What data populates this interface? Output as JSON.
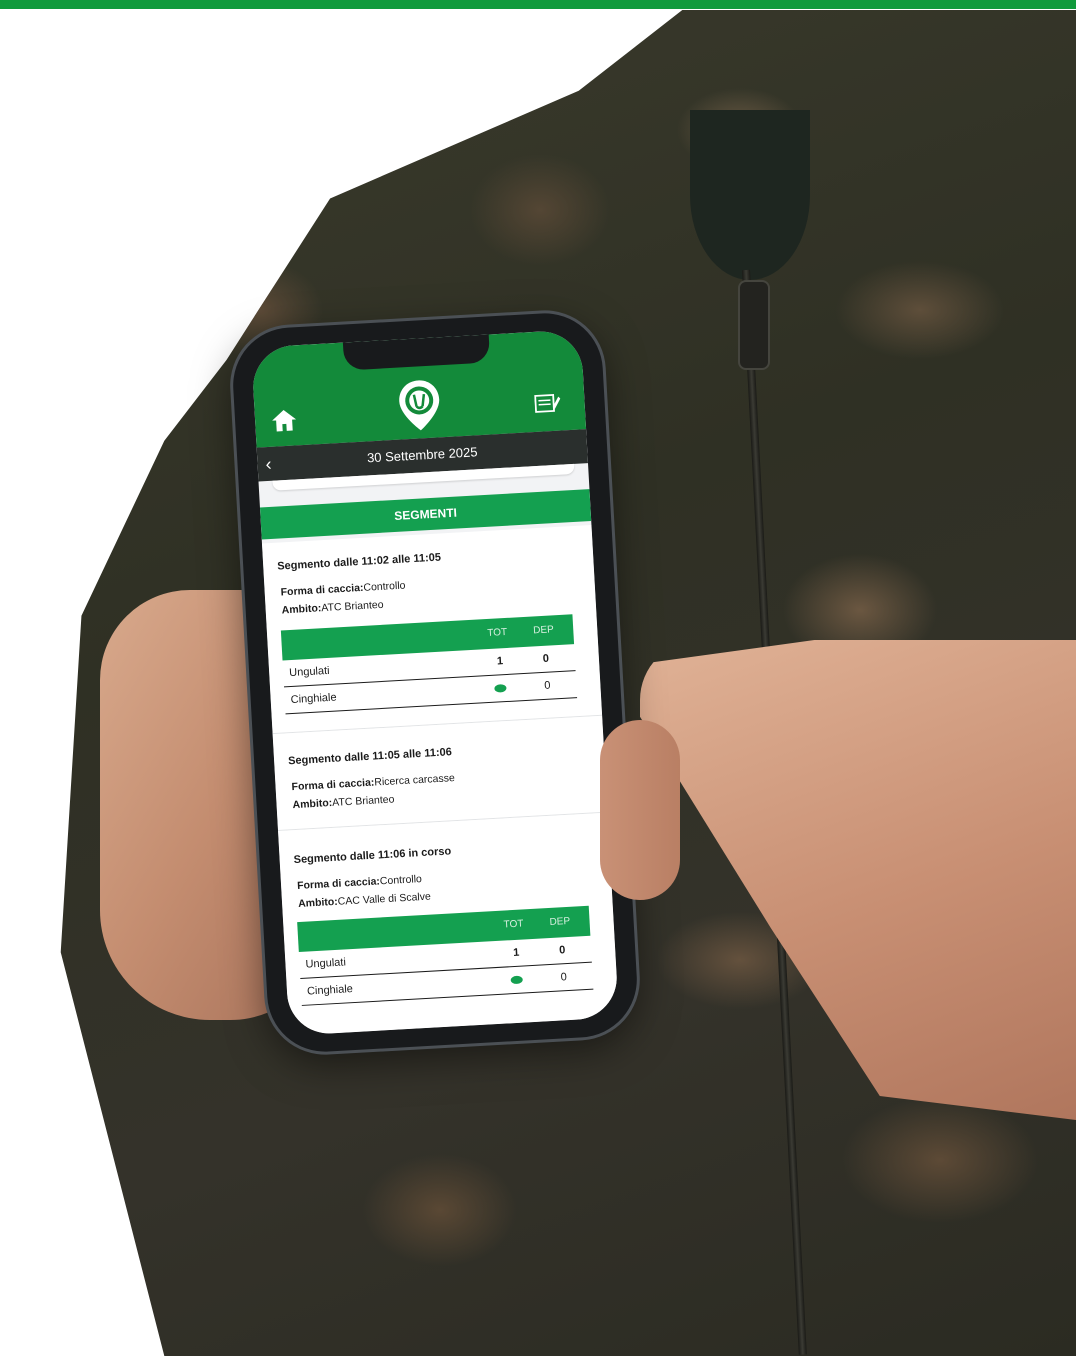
{
  "app": {
    "date": "30 Settembre 2025",
    "segments_header": "SEGMENTI"
  },
  "segments": [
    {
      "title": "Segmento dalle 11:02 alle 11:05",
      "forma_label": "Forma di caccia:",
      "forma_value": "Controllo",
      "ambito_label": "Ambito:",
      "ambito_value": "ATC Brianteo",
      "table": {
        "col_tot": "TOT",
        "col_dep": "DEP",
        "rows": [
          {
            "label": "Ungulati",
            "tot": "1",
            "dep": "0"
          },
          {
            "label": "Cinghiale",
            "tot": "",
            "dep": "0"
          }
        ]
      }
    },
    {
      "title": "Segmento dalle 11:05 alle 11:06",
      "forma_label": "Forma di caccia:",
      "forma_value": "Ricerca carcasse",
      "ambito_label": "Ambito:",
      "ambito_value": "ATC Brianteo"
    },
    {
      "title": "Segmento dalle 11:06 in corso",
      "forma_label": "Forma di caccia:",
      "forma_value": "Controllo",
      "ambito_label": "Ambito:",
      "ambito_value": "CAC Valle di Scalve",
      "table": {
        "col_tot": "TOT",
        "col_dep": "DEP",
        "rows": [
          {
            "label": "Ungulati",
            "tot": "1",
            "dep": "0"
          },
          {
            "label": "Cinghiale",
            "tot": "",
            "dep": "0"
          }
        ]
      }
    }
  ],
  "icons": [
    "home-icon",
    "app-logo-icon",
    "notes-edit-icon",
    "back-chevron-icon"
  ],
  "colors": {
    "brand_green": "#138a3a",
    "accent_green": "#14a050",
    "top_bar": "#109a3c",
    "date_bar": "#2a2f2d"
  }
}
